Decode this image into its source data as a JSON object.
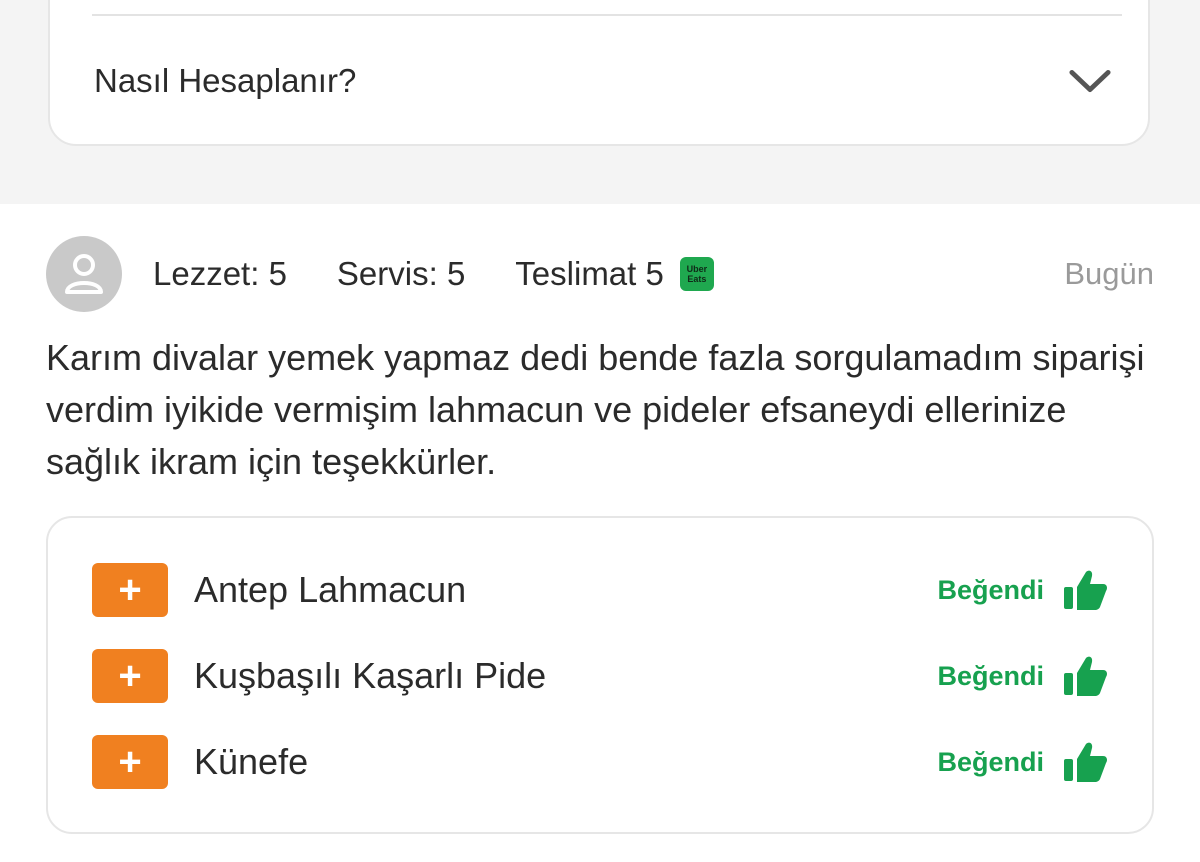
{
  "faq": {
    "title": "Nasıl Hesaplanır?",
    "icon": "chevron-down-icon"
  },
  "review": {
    "avatar_icon": "user-icon",
    "ratings": {
      "taste": "Lezzet: 5",
      "service": "Servis: 5",
      "delivery": "Teslimat 5"
    },
    "delivery_badge": {
      "line1": "Uber",
      "line2": "Eats",
      "color": "#1fa84f"
    },
    "date": "Bugün",
    "text": "Karım divalar yemek yapmaz dedi bende fazla sorgulamadım siparişi verdim iyikide vermişim lahmacun ve pideler efsaneydi ellerinize sağlık ikram için teşekkürler.",
    "items": [
      {
        "add_label": "+",
        "name": "Antep Lahmacun",
        "status": "Beğendi",
        "icon": "thumbs-up-icon"
      },
      {
        "add_label": "+",
        "name": "Kuşbaşılı Kaşarlı Pide",
        "status": "Beğendi",
        "icon": "thumbs-up-icon"
      },
      {
        "add_label": "+",
        "name": "Künefe",
        "status": "Beğendi",
        "icon": "thumbs-up-icon"
      }
    ]
  },
  "colors": {
    "accent_orange": "#f08020",
    "liked_green": "#17a14f",
    "muted_text": "#9a9a9a",
    "section_bg": "#f4f4f4"
  }
}
